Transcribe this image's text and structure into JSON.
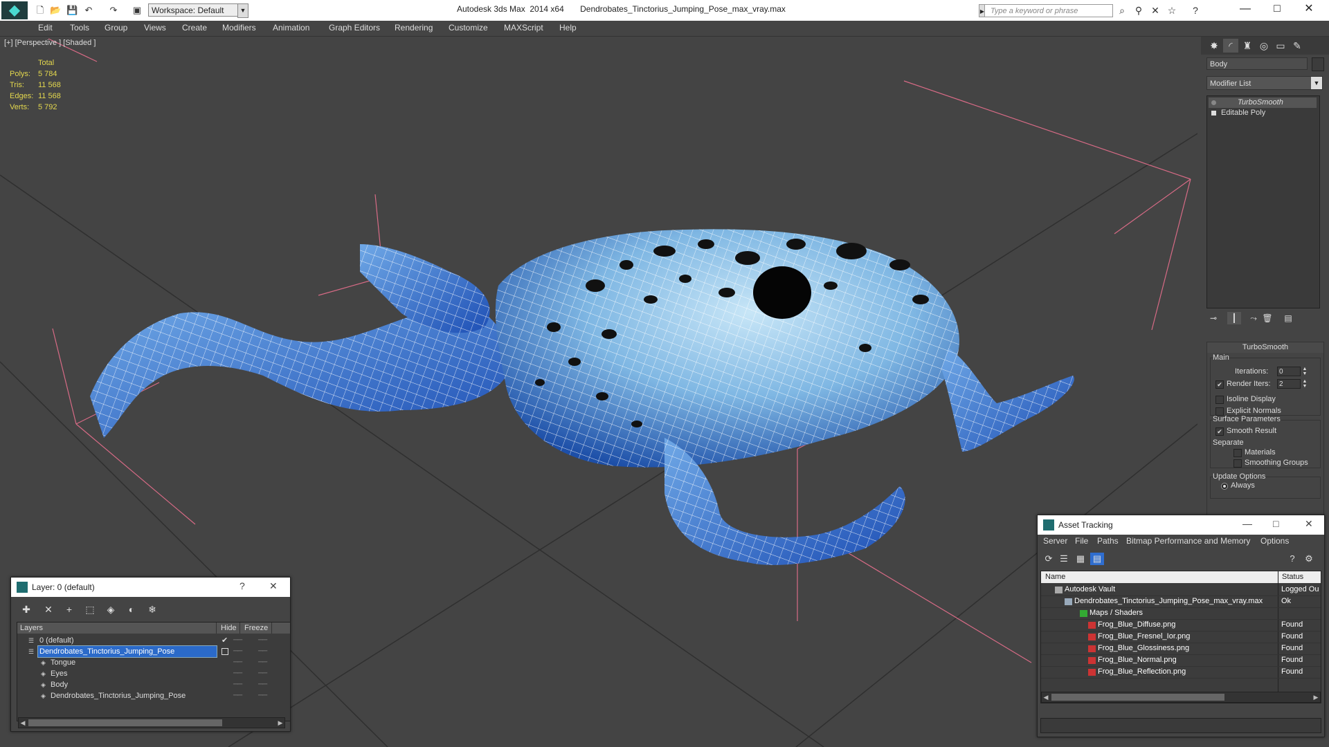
{
  "titlebar": {
    "app_title": "Autodesk 3ds Max  2014 x64",
    "file_name": "Dendrobates_Tinctorius_Jumping_Pose_max_vray.max",
    "workspace": "Workspace: Default",
    "search_placeholder": "Type a keyword or phrase"
  },
  "menu": [
    "Edit",
    "Tools",
    "Group",
    "Views",
    "Create",
    "Modifiers",
    "Animation",
    "Graph Editors",
    "Rendering",
    "Customize",
    "MAXScript",
    "Help"
  ],
  "viewport": {
    "label": "[+] [Perspective ] [Shaded ]",
    "stats": {
      "header": "Total",
      "rows": [
        {
          "k": "Polys:",
          "v": "5 784"
        },
        {
          "k": "Tris:",
          "v": "11 568"
        },
        {
          "k": "Edges:",
          "v": "11 568"
        },
        {
          "k": "Verts:",
          "v": "5 792"
        }
      ]
    }
  },
  "command_panel": {
    "object_name": "Body",
    "modifier_list": "Modifier List",
    "stack": [
      {
        "label": "TurboSmooth",
        "selected": true
      },
      {
        "label": "Editable Poly",
        "selected": false
      }
    ],
    "rollout": {
      "title": "TurboSmooth",
      "main_label": "Main",
      "iterations_label": "Iterations:",
      "iterations_value": "0",
      "render_iters_label": "Render Iters:",
      "render_iters_value": "2",
      "render_iters_checked": true,
      "isoline_label": "Isoline Display",
      "explicit_normals_label": "Explicit Normals",
      "surface_params_label": "Surface Parameters",
      "smooth_result_label": "Smooth Result",
      "smooth_result_checked": true,
      "separate_label": "Separate",
      "materials_label": "Materials",
      "smoothing_groups_label": "Smoothing Groups",
      "update_options_label": "Update Options",
      "always_label": "Always"
    }
  },
  "layer_window": {
    "title": "Layer: 0 (default)",
    "help": "?",
    "close": "✕",
    "columns": {
      "layers": "Layers",
      "hide": "Hide",
      "freeze": "Freeze"
    },
    "rows": [
      {
        "name": "0 (default)",
        "indent": 1,
        "selected": false
      },
      {
        "name": "Dendrobates_Tinctorius_Jumping_Pose",
        "indent": 1,
        "selected": true
      },
      {
        "name": "Tongue",
        "indent": 2,
        "selected": false
      },
      {
        "name": "Eyes",
        "indent": 2,
        "selected": false
      },
      {
        "name": "Body",
        "indent": 2,
        "selected": false
      },
      {
        "name": "Dendrobates_Tinctorius_Jumping_Pose",
        "indent": 2,
        "selected": false
      }
    ]
  },
  "asset_tracking": {
    "title": "Asset Tracking",
    "menu": [
      "Server",
      "File",
      "Paths",
      "Bitmap Performance and Memory",
      "Options"
    ],
    "columns": {
      "name": "Name",
      "status": "Status"
    },
    "rows": [
      {
        "name": "Autodesk Vault",
        "status": "Logged Ou",
        "indent": 1,
        "icon": "vault-icon"
      },
      {
        "name": "Dendrobates_Tinctorius_Jumping_Pose_max_vray.max",
        "status": "Ok",
        "indent": 2,
        "icon": "max-file-icon"
      },
      {
        "name": "Maps / Shaders",
        "status": "",
        "indent": 3,
        "icon": "maps-icon"
      },
      {
        "name": "Frog_Blue_Diffuse.png",
        "status": "Found",
        "indent": 4,
        "icon": "png-icon"
      },
      {
        "name": "Frog_Blue_Fresnel_Ior.png",
        "status": "Found",
        "indent": 4,
        "icon": "png-icon"
      },
      {
        "name": "Frog_Blue_Glossiness.png",
        "status": "Found",
        "indent": 4,
        "icon": "png-icon"
      },
      {
        "name": "Frog_Blue_Normal.png",
        "status": "Found",
        "indent": 4,
        "icon": "png-icon"
      },
      {
        "name": "Frog_Blue_Reflection.png",
        "status": "Found",
        "indent": 4,
        "icon": "png-icon"
      }
    ]
  },
  "colors": {
    "stats_text": "#e4d84e",
    "frog_blue": "#2a62c8",
    "frog_light": "#9fd0ee",
    "grid": "#2f2f2f",
    "bbox": "#d86b86",
    "selection": "#2b6ac9"
  }
}
